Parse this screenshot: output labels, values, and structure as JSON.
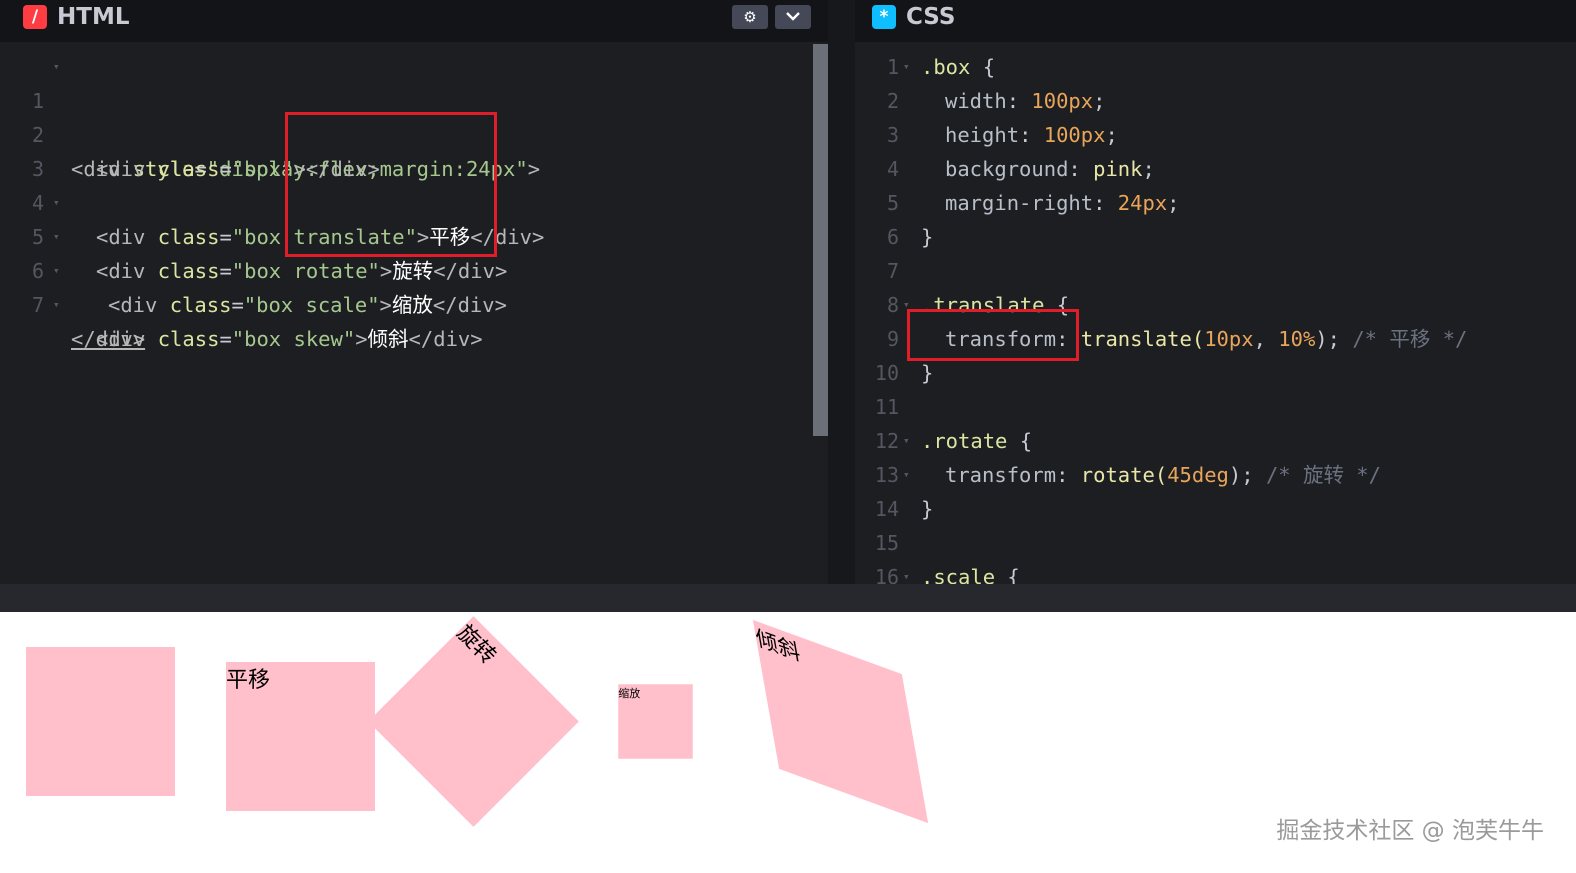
{
  "html_pane": {
    "title": "HTML",
    "badge": "/",
    "lines": [
      {
        "n": "1",
        "fold": true
      },
      {
        "n": "2",
        "fold": false
      },
      {
        "n": "3",
        "fold": true
      },
      {
        "n": "4",
        "fold": true
      },
      {
        "n": "5",
        "fold": true
      },
      {
        "n": "6",
        "fold": true
      },
      {
        "n": "7",
        "fold": false
      }
    ],
    "code": {
      "l1": {
        "open": "<div ",
        "attr": "style",
        "eq": "=",
        "val": "\"display:flex;margin:24px\"",
        "close": ">"
      },
      "l2": {
        "open": "<div ",
        "attr": "class",
        "eq": "=",
        "val": "\"box\"",
        "close": "></div>"
      },
      "l3": {
        "open": "<div ",
        "attr": "class",
        "eq": "=",
        "val": "\"box translate\"",
        "mid": ">",
        "text": "平移",
        "close": "</div>"
      },
      "l4": {
        "open": "<div ",
        "attr": "class",
        "eq": "=",
        "val": "\"box rotate\"",
        "mid": ">",
        "text": "旋转",
        "close": "</div>"
      },
      "l5": {
        "open": "<div ",
        "attr": "class",
        "eq": "=",
        "val": "\"box scale\"",
        "mid": ">",
        "text": "缩放",
        "close": "</div>"
      },
      "l6": {
        "open": "<div ",
        "attr": "class",
        "eq": "=",
        "val": "\"box skew\"",
        "mid": ">",
        "text": "倾斜",
        "close": "</div>"
      },
      "l7": {
        "close": "</div>"
      }
    }
  },
  "css_pane": {
    "title": "CSS",
    "badge": "*",
    "line_numbers": [
      "1",
      "2",
      "3",
      "4",
      "5",
      "6",
      "7",
      "8",
      "9",
      "10",
      "11",
      "12",
      "13",
      "14",
      "15",
      "16"
    ],
    "code": {
      "l1": {
        "sel": ".box",
        "brace": " {"
      },
      "l2": {
        "prop": "width",
        "colon": ": ",
        "val": "100px",
        "end": ";"
      },
      "l3": {
        "prop": "height",
        "colon": ": ",
        "val": "100px",
        "end": ";"
      },
      "l4": {
        "prop": "background",
        "colon": ": ",
        "val": "pink",
        "end": ";"
      },
      "l5": {
        "prop": "margin-right",
        "colon": ": ",
        "val": "24px",
        "end": ";"
      },
      "l6": {
        "brace": "}"
      },
      "l8": {
        "sel": ".translate",
        "brace": " {"
      },
      "l9": {
        "prop": "transform",
        "colon": ": ",
        "fn": "translate(",
        "a1": "10px",
        "sep": ", ",
        "a2": "10%",
        "end": ");",
        "comment": "/* 平移 */"
      },
      "l10": {
        "brace": "}"
      },
      "l12": {
        "sel": ".rotate",
        "brace": " {"
      },
      "l13": {
        "prop": "transform",
        "colon": ": ",
        "fn": "rotate(",
        "a1": "45deg",
        "end": ");",
        "comment": "/* 旋转 */"
      },
      "l14": {
        "brace": "}"
      },
      "l16": {
        "sel": ".scale",
        "brace": " {"
      }
    }
  },
  "preview": {
    "boxes": {
      "translate": "平移",
      "rotate": "旋转",
      "scale": "缩放",
      "skew": "倾斜"
    },
    "box_color": "#ffc0cb"
  },
  "watermark": "掘金技术社区 @ 泡芙牛牛",
  "colors": {
    "editor_bg": "#1d1e22",
    "highlight": "#e01e2a",
    "html_badge": "#ff3c41",
    "css_badge": "#0ebeff"
  }
}
